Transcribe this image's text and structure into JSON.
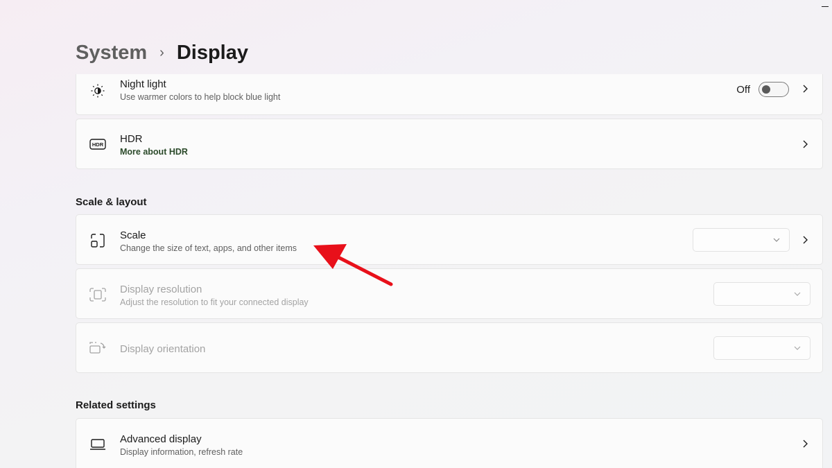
{
  "breadcrumb": {
    "parent": "System",
    "separator": "›",
    "current": "Display"
  },
  "rows": {
    "night_light": {
      "title": "Night light",
      "subtitle": "Use warmer colors to help block blue light",
      "toggle_state": "Off",
      "toggle_on": false,
      "icon": "night-light-icon"
    },
    "hdr": {
      "title": "HDR",
      "link": "More about HDR",
      "icon": "hdr-icon"
    },
    "scale": {
      "title": "Scale",
      "subtitle": "Change the size of text, apps, and other items",
      "icon": "scale-icon",
      "value": ""
    },
    "display_resolution": {
      "title": "Display resolution",
      "subtitle": "Adjust the resolution to fit your connected display",
      "icon": "resolution-icon",
      "value": "",
      "disabled": true
    },
    "display_orientation": {
      "title": "Display orientation",
      "icon": "orientation-icon",
      "value": "",
      "disabled": true
    },
    "advanced_display": {
      "title": "Advanced display",
      "subtitle": "Display information, refresh rate",
      "icon": "monitor-icon"
    }
  },
  "sections": {
    "scale_layout": "Scale & layout",
    "related_settings": "Related settings"
  },
  "annotation": {
    "type": "arrow",
    "color": "#e8101a"
  },
  "colors": {
    "link_green": "#2b4a2a",
    "disabled_text": "#a3a3a3"
  }
}
